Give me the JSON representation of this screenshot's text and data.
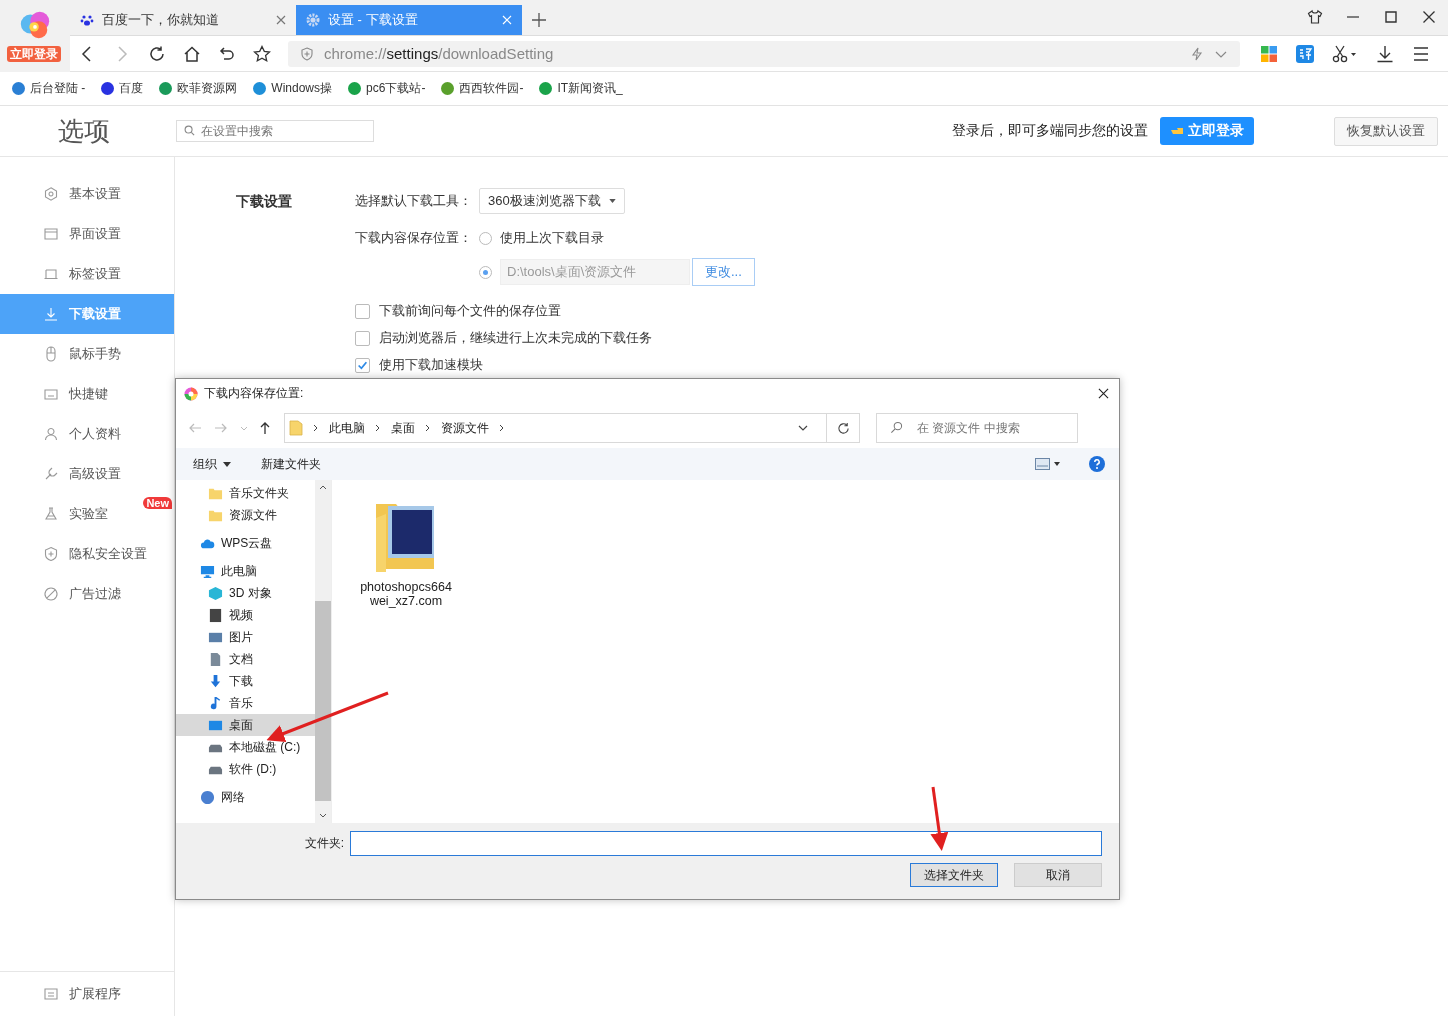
{
  "browser": {
    "tabs": [
      {
        "label": "百度一下，你就知道",
        "selected": false
      },
      {
        "label": "设置 - 下载设置",
        "selected": true
      }
    ],
    "login_badge": "立即登录",
    "address": {
      "scheme": "chrome://",
      "host": "settings",
      "path": "/downloadSetting"
    },
    "bookmarks": [
      {
        "label": "后台登陆 -",
        "color": "#2a7fd4"
      },
      {
        "label": "百度",
        "color": "#2932e1"
      },
      {
        "label": "欧菲资源网",
        "color": "#1a9a5a"
      },
      {
        "label": "Windows操",
        "color": "#1e8fd8"
      },
      {
        "label": "pc6下载站-",
        "color": "#1aa34a"
      },
      {
        "label": "西西软件园-",
        "color": "#5aa02c"
      },
      {
        "label": "IT新闻资讯_",
        "color": "#1aa34a"
      }
    ]
  },
  "settings": {
    "title": "选项",
    "search": {
      "placeholder": "在设置中搜索"
    },
    "sync_text": "登录后，即可多端同步您的设置",
    "login_button": "立即登录",
    "restore_button": "恢复默认设置",
    "nav": [
      {
        "label": "基本设置",
        "selected": false
      },
      {
        "label": "界面设置",
        "selected": false
      },
      {
        "label": "标签设置",
        "selected": false
      },
      {
        "label": "下载设置",
        "selected": true
      },
      {
        "label": "鼠标手势",
        "selected": false
      },
      {
        "label": "快捷键",
        "selected": false
      },
      {
        "label": "个人资料",
        "selected": false
      },
      {
        "label": "高级设置",
        "selected": false
      },
      {
        "label": "实验室",
        "selected": false,
        "badge": "New"
      },
      {
        "label": "隐私安全设置",
        "selected": false
      },
      {
        "label": "广告过滤",
        "selected": false
      }
    ],
    "footer_link": "扩展程序",
    "section": {
      "heading": "下载设置",
      "tool_label": "选择默认下载工具：",
      "tool_value": "360极速浏览器下载",
      "location_label": "下载内容保存位置：",
      "location_options": [
        {
          "kind": "text",
          "label": "使用上次下载目录",
          "selected": false
        },
        {
          "kind": "path",
          "value": "D:\\tools\\桌面\\资源文件",
          "button": "更改...",
          "selected": true
        }
      ],
      "checkboxes": [
        {
          "label": "下载前询问每个文件的保存位置",
          "checked": false
        },
        {
          "label": "启动浏览器后，继续进行上次未完成的下载任务",
          "checked": false
        },
        {
          "label": "使用下载加速模块",
          "checked": true
        }
      ]
    }
  },
  "dialog": {
    "title": "下载内容保存位置:",
    "breadcrumb": [
      "此电脑",
      "桌面",
      "资源文件"
    ],
    "search": {
      "placeholder": "在 资源文件 中搜索"
    },
    "organize": "组织",
    "new_folder": "新建文件夹",
    "tree": [
      {
        "label": "音乐文件夹",
        "kind": "folder",
        "selected": false
      },
      {
        "label": "资源文件",
        "kind": "folder",
        "selected": false
      },
      {
        "label": "WPS云盘",
        "kind": "cloud",
        "selected": false
      },
      {
        "label": "此电脑",
        "kind": "pc",
        "selected": false,
        "children": [
          {
            "label": "3D 对象",
            "kind": "cube",
            "selected": false
          },
          {
            "label": "视频",
            "kind": "film",
            "selected": false
          },
          {
            "label": "图片",
            "kind": "picture",
            "selected": false
          },
          {
            "label": "文档",
            "kind": "doc",
            "selected": false
          },
          {
            "label": "下载",
            "kind": "download",
            "selected": false
          },
          {
            "label": "音乐",
            "kind": "music",
            "selected": false
          },
          {
            "label": "桌面",
            "kind": "desktop",
            "selected": true
          },
          {
            "label": "本地磁盘 (C:)",
            "kind": "drive",
            "selected": false
          },
          {
            "label": "软件 (D:)",
            "kind": "drive",
            "selected": false
          }
        ]
      },
      {
        "label": "网络",
        "kind": "network",
        "selected": false
      }
    ],
    "files": [
      {
        "name": "photoshopcs664wei_xz7.com"
      }
    ],
    "folder_label": "文件夹:",
    "buttons": [
      "选择文件夹",
      "取消"
    ]
  }
}
